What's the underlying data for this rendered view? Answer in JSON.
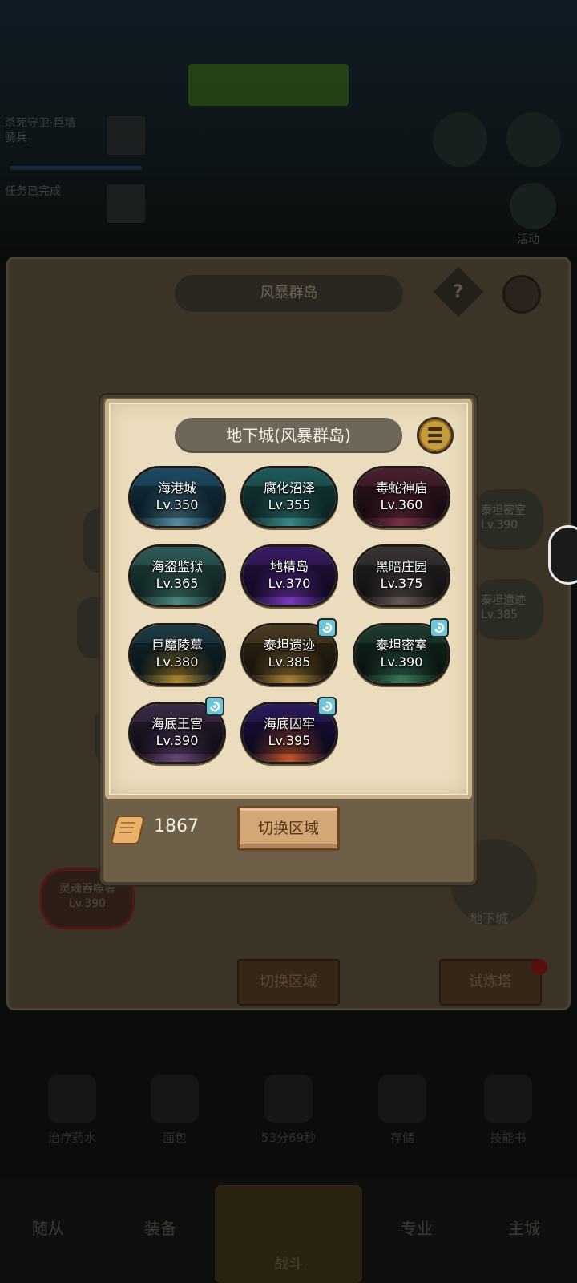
{
  "background": {
    "banner_text": "",
    "main_panel_title": "风暴群岛",
    "help_label": "?",
    "quests": [
      {
        "label": "杀死守卫·巨墙\n骑兵"
      },
      {
        "label": "任务已完成"
      }
    ],
    "right_icons": [
      {
        "label": "活动"
      }
    ],
    "map_nodes": [
      {
        "label": "泰坦密室",
        "level": "Lv.390"
      },
      {
        "label": "泰坦遗迹",
        "level": "Lv.385"
      }
    ],
    "soul_node": {
      "label": "灵魂吞噬者",
      "level": "Lv.390"
    },
    "dungeon_button_label": "地下城",
    "switch_zone_label": "切换区域",
    "trial_tower_label": "试炼塔",
    "bottom_row": [
      {
        "label": "治疗药水"
      },
      {
        "label": "面包"
      },
      {
        "label": "53分69秒"
      },
      {
        "label": "存储"
      },
      {
        "label": "技能书"
      }
    ],
    "nav_tabs": [
      {
        "label": "随从"
      },
      {
        "label": "装备"
      },
      {
        "label": "战斗"
      },
      {
        "label": "专业"
      },
      {
        "label": "主城"
      }
    ]
  },
  "dialog": {
    "title": "地下城(风暴群岛)",
    "dungeons": [
      {
        "name": "海港城",
        "level": "Lv.350",
        "swirl": false,
        "colors": [
          "#1e4a63",
          "#0c2431",
          "#5a8fa6"
        ]
      },
      {
        "name": "腐化沼泽",
        "level": "Lv.355",
        "swirl": false,
        "colors": [
          "#1f5a5a",
          "#0f2d2e",
          "#3b8a8a"
        ]
      },
      {
        "name": "毒蛇神庙",
        "level": "Lv.360",
        "swirl": false,
        "colors": [
          "#4a2030",
          "#1a0c14",
          "#7a3346"
        ]
      },
      {
        "name": "海盗监狱",
        "level": "Lv.365",
        "swirl": false,
        "colors": [
          "#2e5a57",
          "#142e2c",
          "#4e8a84"
        ]
      },
      {
        "name": "地精岛",
        "level": "Lv.370",
        "swirl": false,
        "colors": [
          "#3a1c62",
          "#160a2a",
          "#7a3cc2"
        ]
      },
      {
        "name": "黑暗庄园",
        "level": "Lv.375",
        "swirl": false,
        "colors": [
          "#3a3434",
          "#161414",
          "#6a5a5a"
        ]
      },
      {
        "name": "巨魔陵墓",
        "level": "Lv.380",
        "swirl": false,
        "colors": [
          "#1e3a44",
          "#0c1c22",
          "#b08a2c"
        ]
      },
      {
        "name": "泰坦遗迹",
        "level": "Lv.385",
        "swirl": true,
        "colors": [
          "#4a3a24",
          "#1f170c",
          "#a8843c"
        ]
      },
      {
        "name": "泰坦密室",
        "level": "Lv.390",
        "swirl": true,
        "colors": [
          "#1e3a2e",
          "#0c1a14",
          "#3a7a5a"
        ]
      },
      {
        "name": "海底王宫",
        "level": "Lv.390",
        "swirl": true,
        "colors": [
          "#3a2a44",
          "#180f1e",
          "#6a4a7a"
        ]
      },
      {
        "name": "海底囚牢",
        "level": "Lv.395",
        "swirl": true,
        "colors": [
          "#2a1a5a",
          "#110a26",
          "#c85a2a"
        ]
      }
    ],
    "currency_amount": "1867",
    "switch_zone_button": "切换区域"
  },
  "colors": {
    "parchment": "#eadcbc",
    "title_pill": "#6f665a",
    "menu_gold": "#c79a3c",
    "swirl_badge": "#6fc5d6",
    "wood_button": "#d4a777"
  }
}
